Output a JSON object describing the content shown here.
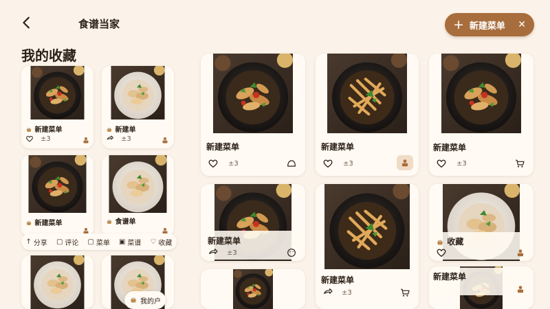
{
  "header": {
    "app_title": "食谱当家",
    "new_menu_label": "新建菜单",
    "section_title": "我的收藏"
  },
  "left_cards": [
    {
      "title": "新建菜单"
    },
    {
      "title": "新建单"
    },
    {
      "title": "新建菜单"
    },
    {
      "title": "食谱单"
    }
  ],
  "left_meta_num": "±3",
  "action_bar": {
    "items": [
      {
        "label": "分享",
        "icon": "share-icon"
      },
      {
        "label": "评论",
        "icon": "comment-icon"
      },
      {
        "label": "菜单",
        "icon": "menu-icon"
      },
      {
        "label": "菜谱",
        "icon": "recipe-icon"
      },
      {
        "label": "收藏",
        "icon": "heart-icon"
      }
    ]
  },
  "right_cards": [
    {
      "title": "新建菜单"
    },
    {
      "title": "新建菜单"
    },
    {
      "title": "新建菜单"
    },
    {
      "title": "新建菜单"
    },
    {
      "title": "新建菜单"
    },
    {
      "title": "新建菜单"
    },
    {
      "title": "收藏"
    }
  ],
  "right_meta_num": "±3",
  "floating_pill": {
    "label": "我的户"
  },
  "colors": {
    "accent": "#a86d3c",
    "background": "#fbf3ea",
    "card": "#fffaf3"
  }
}
